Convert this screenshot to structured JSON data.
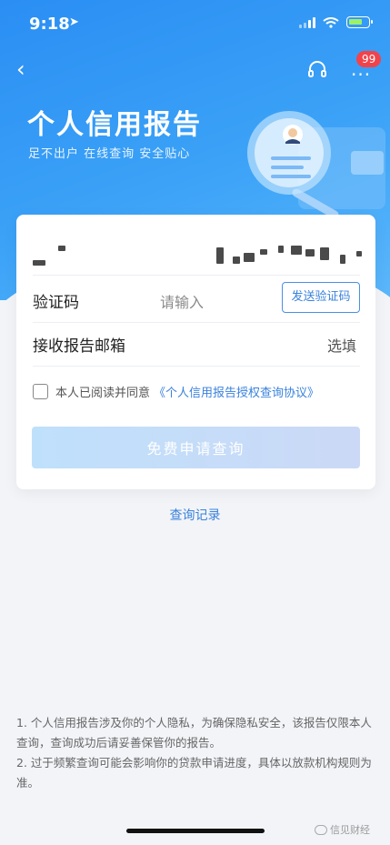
{
  "status_bar": {
    "time": "9:18",
    "location_arrow": "➤"
  },
  "nav": {
    "back_glyph": "‹",
    "more_glyph": "···",
    "badge_count": "99"
  },
  "header": {
    "title": "个人信用报告",
    "subtitle": "足不出户 在线查询 安全贴心"
  },
  "form": {
    "phone_prefix": "",
    "verification": {
      "label": "验证码",
      "placeholder": "请输入",
      "send_button": "发送验证码"
    },
    "email": {
      "label": "接收报告邮箱",
      "select": "选填"
    },
    "agreement": {
      "text": "本人已阅读并同意",
      "link": "《个人信用报告授权查询协议》"
    },
    "submit": "免费申请查询"
  },
  "history_link": "查询记录",
  "notes": [
    "1. 个人信用报告涉及你的个人隐私，为确保隐私安全，该报告仅限本人查询，查询成功后请妥善保管你的报告。",
    "2. 过于频繁查询可能会影响你的贷款申请进度，具体以放款机构规则为准。"
  ],
  "watermark": "信见财经",
  "colors": {
    "accent": "#3a82dc",
    "header": "#2a8ef3",
    "badge": "#f2434b"
  }
}
